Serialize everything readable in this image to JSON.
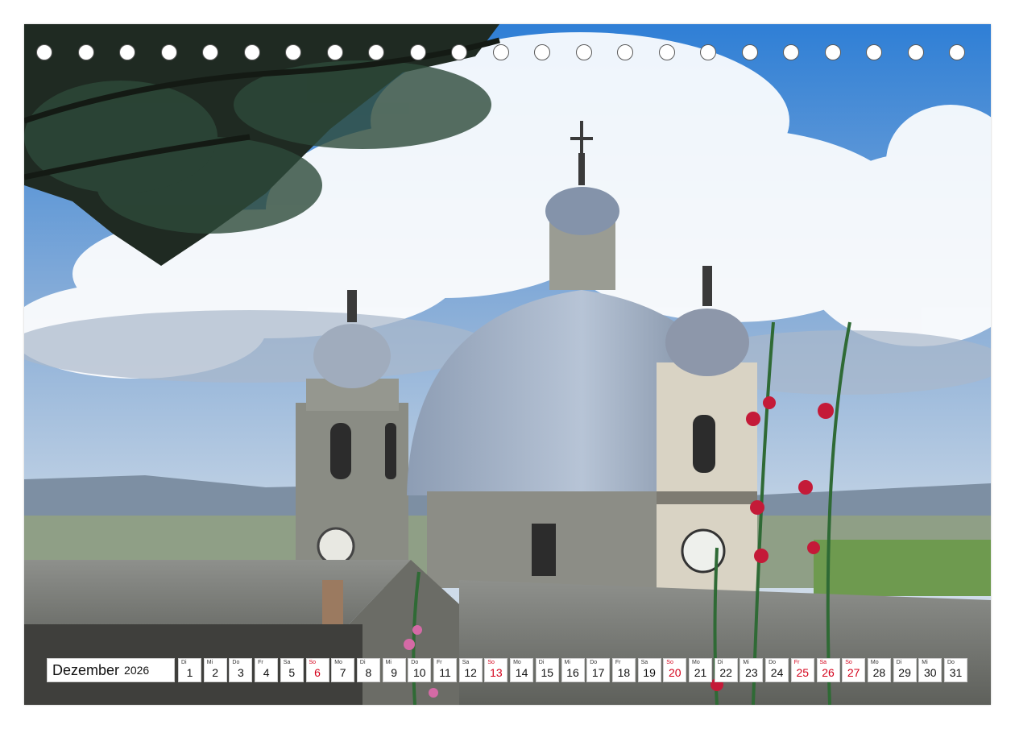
{
  "calendar": {
    "month": "Dezember",
    "year": "2026",
    "holiday_color": "#d4001a",
    "days": [
      {
        "dow": "Di",
        "num": "1",
        "red": false
      },
      {
        "dow": "Mi",
        "num": "2",
        "red": false
      },
      {
        "dow": "Do",
        "num": "3",
        "red": false
      },
      {
        "dow": "Fr",
        "num": "4",
        "red": false
      },
      {
        "dow": "Sa",
        "num": "5",
        "red": false
      },
      {
        "dow": "So",
        "num": "6",
        "red": true
      },
      {
        "dow": "Mo",
        "num": "7",
        "red": false
      },
      {
        "dow": "Di",
        "num": "8",
        "red": false
      },
      {
        "dow": "Mi",
        "num": "9",
        "red": false
      },
      {
        "dow": "Do",
        "num": "10",
        "red": false
      },
      {
        "dow": "Fr",
        "num": "11",
        "red": false
      },
      {
        "dow": "Sa",
        "num": "12",
        "red": false
      },
      {
        "dow": "So",
        "num": "13",
        "red": true
      },
      {
        "dow": "Mo",
        "num": "14",
        "red": false
      },
      {
        "dow": "Di",
        "num": "15",
        "red": false
      },
      {
        "dow": "Mi",
        "num": "16",
        "red": false
      },
      {
        "dow": "Do",
        "num": "17",
        "red": false
      },
      {
        "dow": "Fr",
        "num": "18",
        "red": false
      },
      {
        "dow": "Sa",
        "num": "19",
        "red": false
      },
      {
        "dow": "So",
        "num": "20",
        "red": true
      },
      {
        "dow": "Mo",
        "num": "21",
        "red": false
      },
      {
        "dow": "Di",
        "num": "22",
        "red": false
      },
      {
        "dow": "Mi",
        "num": "23",
        "red": false
      },
      {
        "dow": "Do",
        "num": "24",
        "red": false
      },
      {
        "dow": "Fr",
        "num": "25",
        "red": true
      },
      {
        "dow": "Sa",
        "num": "26",
        "red": true
      },
      {
        "dow": "So",
        "num": "27",
        "red": true
      },
      {
        "dow": "Mo",
        "num": "28",
        "red": false
      },
      {
        "dow": "Di",
        "num": "29",
        "red": false
      },
      {
        "dow": "Mi",
        "num": "30",
        "red": false
      },
      {
        "dow": "Do",
        "num": "31",
        "red": false
      }
    ]
  }
}
